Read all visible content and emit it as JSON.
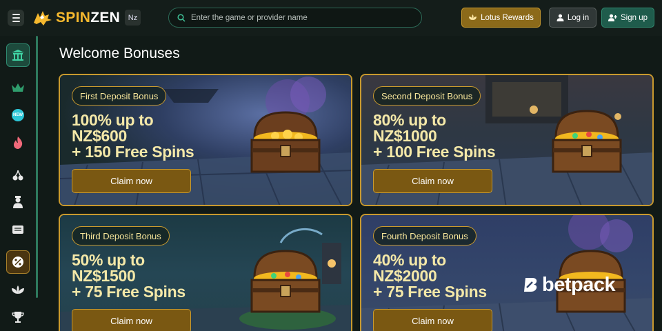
{
  "header": {
    "logo_text_1": "SPIN",
    "logo_text_2": "ZEN",
    "country": "Nz",
    "search_placeholder": "Enter the game or provider name",
    "lotus_label": "Lotus Rewards",
    "login_label": "Log in",
    "signup_label": "Sign up"
  },
  "sidebar": {
    "items": [
      {
        "icon": "temple-icon"
      },
      {
        "icon": "crown-icon"
      },
      {
        "icon": "new-badge-icon",
        "text": "NEW"
      },
      {
        "icon": "fire-icon"
      },
      {
        "icon": "cherries-icon"
      },
      {
        "icon": "dealer-icon"
      },
      {
        "icon": "ticket-icon"
      },
      {
        "icon": "percent-icon"
      },
      {
        "icon": "lotus-icon"
      },
      {
        "icon": "trophy-icon"
      }
    ]
  },
  "main": {
    "title": "Welcome Bonuses",
    "cards": [
      {
        "badge": "First Deposit Bonus",
        "line1": "100% up to",
        "line2": "NZ$600",
        "line3": "+ 150 Free Spins",
        "button": "Claim now"
      },
      {
        "badge": "Second Deposit Bonus",
        "line1": "80% up to",
        "line2": "NZ$1000",
        "line3": "+ 100 Free Spins",
        "button": "Claim now"
      },
      {
        "badge": "Third Deposit Bonus",
        "line1": "50% up to",
        "line2": "NZ$1500",
        "line3": "+ 75 Free Spins",
        "button": "Claim now"
      },
      {
        "badge": "Fourth Deposit Bonus",
        "line1": "40% up to",
        "line2": "NZ$2000",
        "line3": "+ 75 Free Spins",
        "button": "Claim now"
      }
    ]
  },
  "watermark": "betpack",
  "colors": {
    "accent_gold": "#c99a2e",
    "accent_green": "#2f8a70",
    "background": "#111a17"
  }
}
